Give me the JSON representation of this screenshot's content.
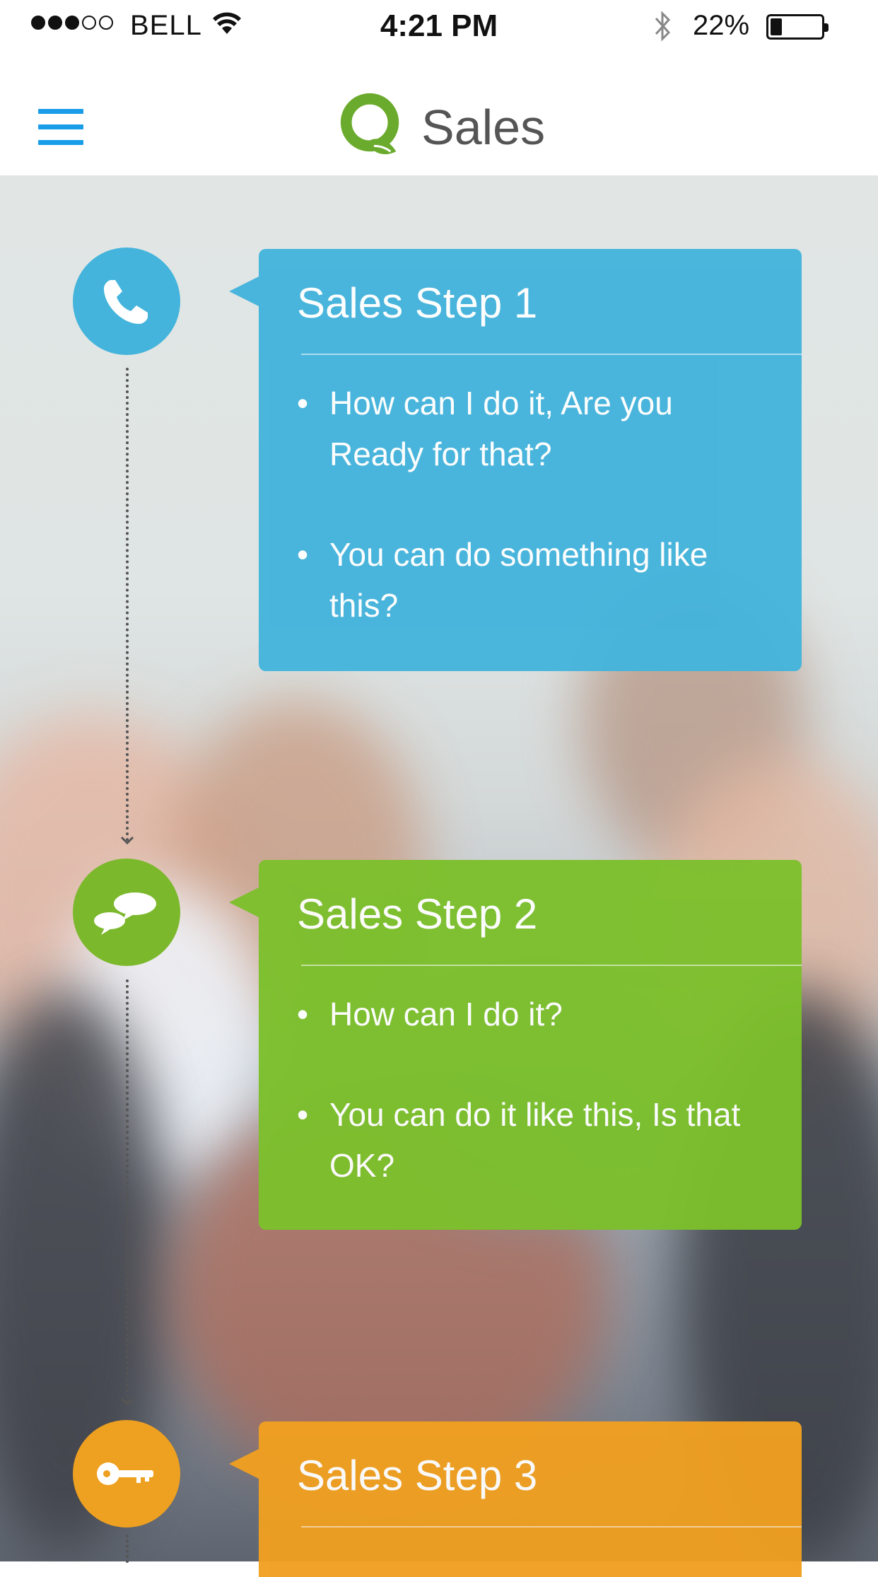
{
  "status_bar": {
    "carrier": "BELL",
    "time": "4:21 PM",
    "battery_percent": "22%"
  },
  "header": {
    "title": "Sales"
  },
  "steps": [
    {
      "title": "Sales Step 1",
      "icon": "phone-icon",
      "color": "#44b4dc",
      "bullets": [
        "How can I do it, Are you Ready for that?",
        "You can do something like this?"
      ]
    },
    {
      "title": "Sales Step 2",
      "icon": "chat-bubbles-icon",
      "color": "#7cc02c",
      "bullets": [
        "How can I do it?",
        "You can do it like this, Is that OK?"
      ]
    },
    {
      "title": "Sales Step 3",
      "icon": "key-icon",
      "color": "#f0a020",
      "bullets": []
    }
  ],
  "colors": {
    "accent": "#1a9de8",
    "logo_green": "#6aaa2c"
  }
}
